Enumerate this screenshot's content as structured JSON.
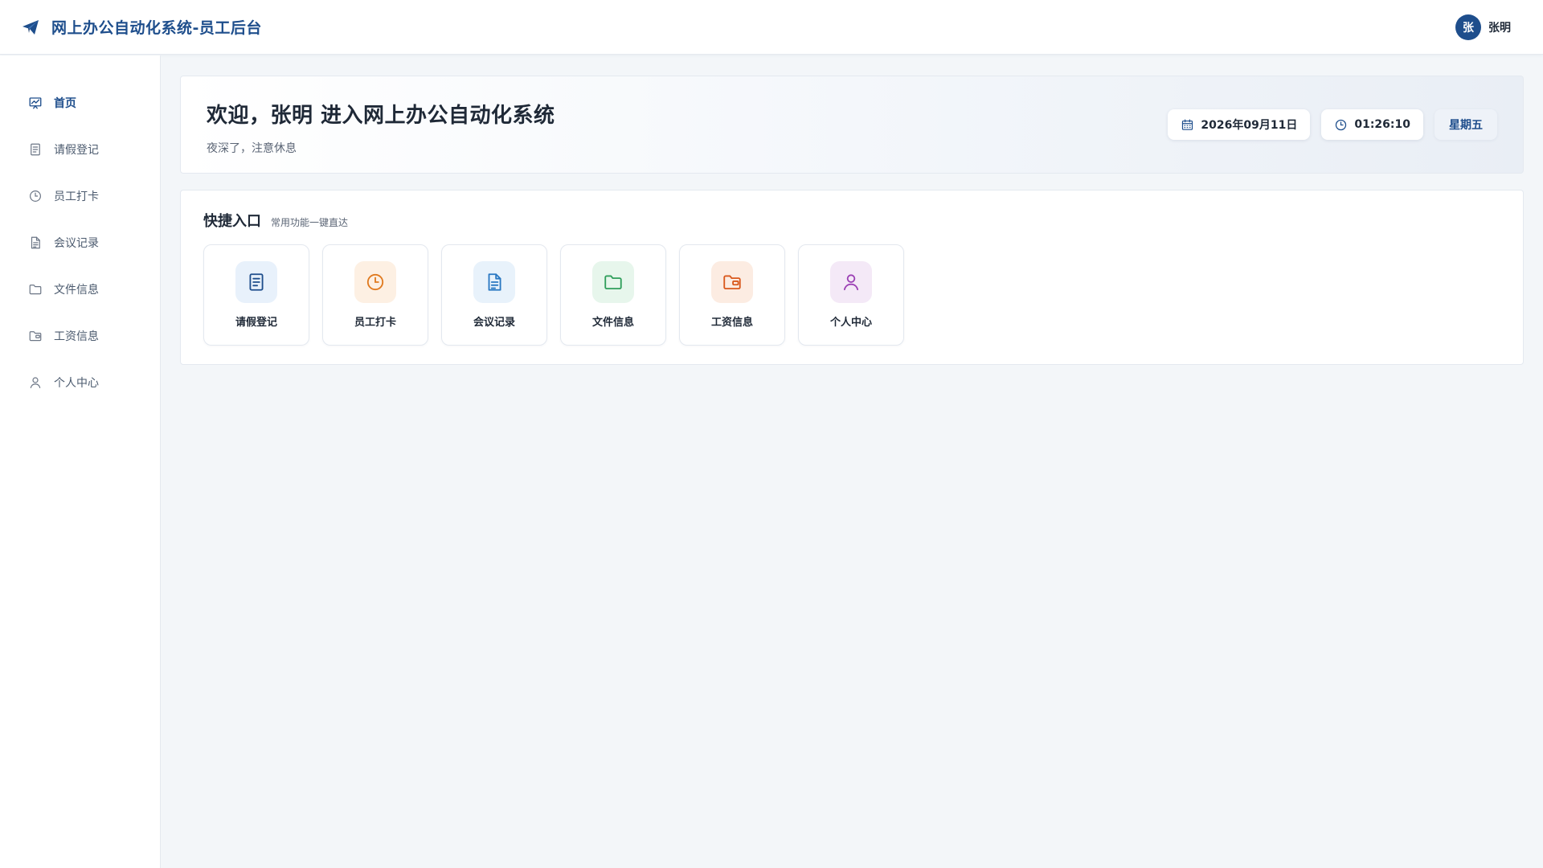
{
  "header": {
    "title": "网上办公自动化系统-员工后台",
    "brand_icon": "paper-plane-icon",
    "user": {
      "avatar_text": "张",
      "name": "张明"
    }
  },
  "sidebar": {
    "items": [
      {
        "label": "首页",
        "icon": "dashboard-chart-icon",
        "active": true
      },
      {
        "label": "请假登记",
        "icon": "document-icon"
      },
      {
        "label": "员工打卡",
        "icon": "clock-icon"
      },
      {
        "label": "会议记录",
        "icon": "file-text-icon"
      },
      {
        "label": "文件信息",
        "icon": "folder-icon"
      },
      {
        "label": "工资信息",
        "icon": "wallet-folder-icon"
      },
      {
        "label": "个人中心",
        "icon": "user-icon"
      }
    ]
  },
  "welcome": {
    "title": "欢迎，张明 进入网上办公自动化系统",
    "subtitle": "夜深了，注意休息",
    "date": "2026年09月11日",
    "time": "01:26:10",
    "weekday": "星期五"
  },
  "quick": {
    "title": "快捷入口",
    "subtitle": "常用功能一键直达",
    "tiles": [
      {
        "label": "请假登记",
        "icon": "document-icon",
        "bg": "#e8f1fb",
        "color": "#1e4e8c"
      },
      {
        "label": "员工打卡",
        "icon": "clock-icon",
        "bg": "#fdf0e3",
        "color": "#e07a1f"
      },
      {
        "label": "会议记录",
        "icon": "file-text-icon",
        "bg": "#e8f2fb",
        "color": "#2a78c2"
      },
      {
        "label": "文件信息",
        "icon": "folder-icon",
        "bg": "#e7f6ec",
        "color": "#2f9e5b"
      },
      {
        "label": "工资信息",
        "icon": "wallet-folder-icon",
        "bg": "#fcece2",
        "color": "#d9581c"
      },
      {
        "label": "个人中心",
        "icon": "user-icon",
        "bg": "#f4e9f7",
        "color": "#9b3fb4"
      }
    ]
  },
  "colors": {
    "primary": "#1e4e8c",
    "background": "#f3f6f9"
  }
}
